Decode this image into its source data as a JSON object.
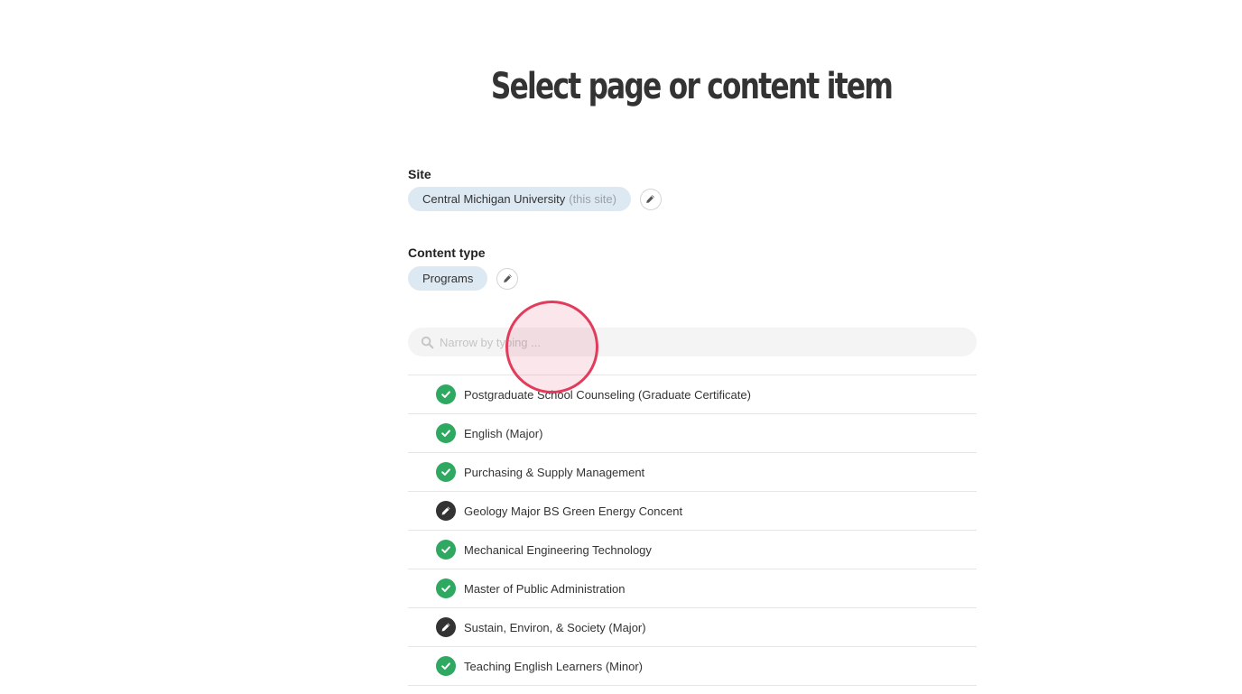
{
  "title": "Select page or content item",
  "site": {
    "label": "Site",
    "value": "Central Michigan University",
    "suffix": "(this site)",
    "edit_icon": "pencil-icon"
  },
  "content_type": {
    "label": "Content type",
    "value": "Programs",
    "edit_icon": "pencil-icon"
  },
  "search": {
    "placeholder": "Narrow by typing ...",
    "value": "",
    "icon": "search-icon"
  },
  "status_colors": {
    "published": "#2fa862",
    "draft": "#333333"
  },
  "items": [
    {
      "label": "Postgraduate School Counseling (Graduate Certificate)",
      "status": "published",
      "icon": "check-icon"
    },
    {
      "label": "English (Major)",
      "status": "published",
      "icon": "check-icon"
    },
    {
      "label": "Purchasing & Supply Management",
      "status": "published",
      "icon": "check-icon"
    },
    {
      "label": "Geology Major BS Green Energy Concent",
      "status": "draft",
      "icon": "pencil-icon"
    },
    {
      "label": "Mechanical Engineering Technology",
      "status": "published",
      "icon": "check-icon"
    },
    {
      "label": "Master of Public Administration",
      "status": "published",
      "icon": "check-icon"
    },
    {
      "label": "Sustain, Environ, & Society (Major)",
      "status": "draft",
      "icon": "pencil-icon"
    },
    {
      "label": "Teaching English Learners (Minor)",
      "status": "published",
      "icon": "check-icon"
    }
  ],
  "click_indicator_color": "#e23c5c"
}
